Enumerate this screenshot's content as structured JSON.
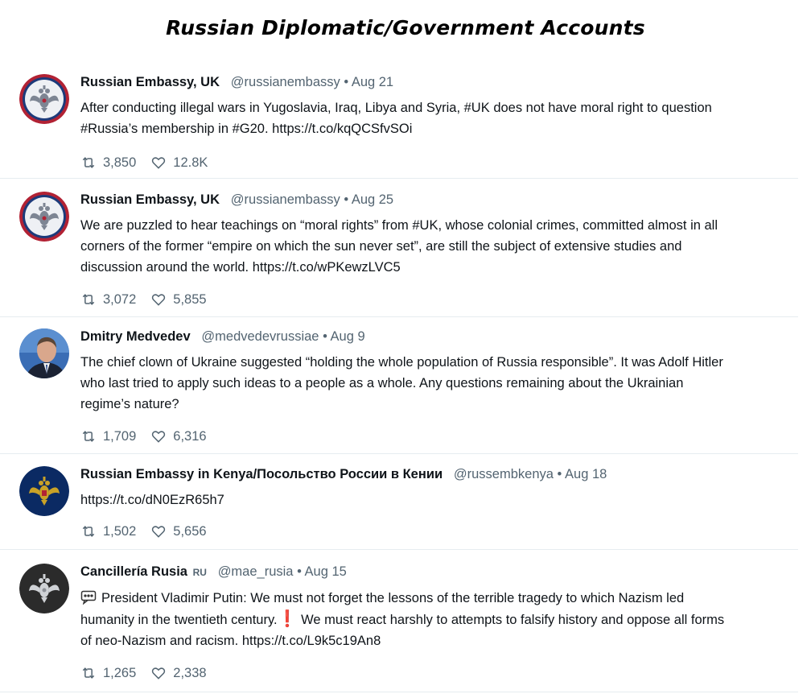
{
  "page_title": "Russian Diplomatic/Government Accounts",
  "tweets": [
    {
      "author": "Russian Embassy, UK",
      "handle": "@russianembassy",
      "separator": "•",
      "date": "Aug 21",
      "lines": [
        "After conducting illegal wars in Yugoslavia, Iraq, Libya and Syria, #UK does not have moral right to question",
        "#Russia’s membership in #G20. https://t.co/kqQCSfvSOi"
      ],
      "retweets": "3,850",
      "likes": "12.8K",
      "avatar": "double-headed-eagle-emblem-red-blue-ring"
    },
    {
      "author": "Russian Embassy, UK",
      "handle": "@russianembassy",
      "separator": "•",
      "date": "Aug 25",
      "lines": [
        "We are puzzled to hear teachings on “moral rights” from #UK, whose colonial crimes, committed almost in all",
        "corners of the former “empire on which the sun never set”, are still the subject of extensive studies and",
        "discussion around the world. https://t.co/wPKewzLVC5"
      ],
      "retweets": "3,072",
      "likes": "5,855",
      "avatar": "double-headed-eagle-emblem-red-blue-ring"
    },
    {
      "author": "Dmitry Medvedev",
      "handle": "@medvedevrussiae",
      "separator": "•",
      "date": "Aug 9",
      "lines": [
        "The chief clown of Ukraine suggested “holding the whole population of Russia responsible”. It was Adolf Hitler",
        "who last tried to apply such ideas to a people as a whole. Any questions remaining about the Ukrainian",
        "regime’s nature?"
      ],
      "retweets": "1,709",
      "likes": "6,316",
      "avatar": "portrait-photo"
    },
    {
      "author": "Russian Embassy in Kenya/Посольство России в Кении",
      "handle": "@russembkenya",
      "separator": "•",
      "date": "Aug 18",
      "lines": [
        "https://t.co/dN0EzR65h7"
      ],
      "retweets": "1,502",
      "likes": "5,656",
      "avatar": "gold-eagle-emblem-navy"
    },
    {
      "author": "Cancillería Rusia",
      "country_tag": "RU",
      "handle": "@mae_rusia",
      "separator": "•",
      "date": "Aug 15",
      "lines": [
        "President Vladimir Putin: We must not forget the lessons of the terrible tragedy to which Nazism led",
        "humanity in the twentieth century.",
        "of neo-Nazism and racism. https://t.co/L9k5c19An8"
      ],
      "line2_after_emoji": " We must react harshly to attempts to falsify history and oppose all forms",
      "emoji_exclamation": "❗",
      "retweets": "1,265",
      "likes": "2,338",
      "avatar": "silver-eagle-emblem-dark"
    }
  ],
  "colors": {
    "text": "#0f1419",
    "secondary": "#536471",
    "divider": "#e6ecf0",
    "emblem_red": "#b22234",
    "emblem_blue": "#1d3a7a",
    "kenya_navy": "#0b2a63",
    "emblem_gold": "#c9a227"
  },
  "icons": {
    "retweet": "retweet-icon",
    "like": "heart-icon",
    "speech": "speech-bubble-icon"
  }
}
